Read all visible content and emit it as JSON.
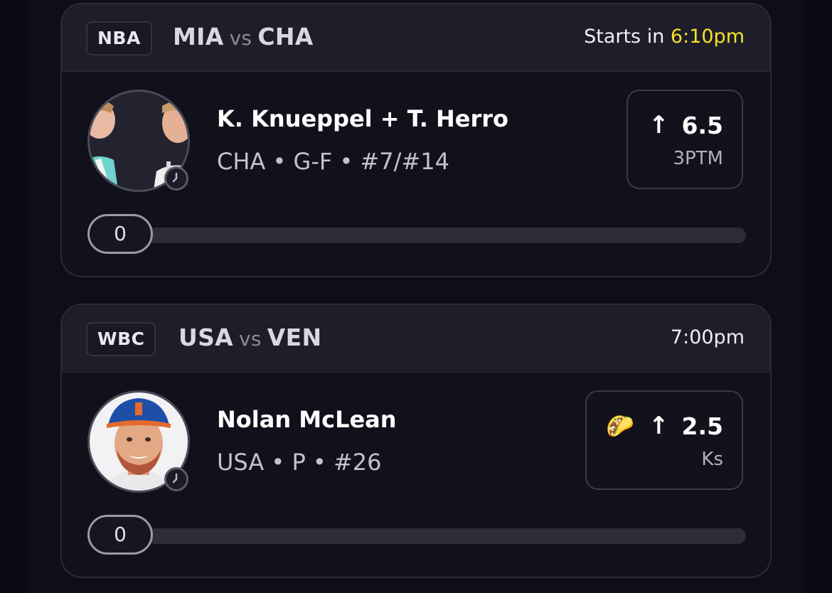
{
  "cards": [
    {
      "league": "NBA",
      "team_a": "MIA",
      "vs": "vs",
      "team_b": "CHA",
      "start_prefix": "Starts in",
      "start_time": "6:10pm",
      "player_name": "K. Knueppel + T. Herro",
      "player_meta": "CHA • G-F • #7/#14",
      "prop_arrow": "↑",
      "prop_value": "6.5",
      "prop_stat": "3PTM",
      "progress_value": "0",
      "icons": {
        "avatar": "player-duo-photo",
        "clock": "clock-icon",
        "arrow": "arrow-up-icon"
      }
    },
    {
      "league": "WBC",
      "team_a": "USA",
      "vs": "vs",
      "team_b": "VEN",
      "start_time": "7:00pm",
      "player_name": "Nolan McLean",
      "player_meta": "USA • P • #26",
      "prop_emoji": "🌮",
      "prop_arrow": "↑",
      "prop_value": "2.5",
      "prop_stat": "Ks",
      "progress_value": "0",
      "icons": {
        "avatar": "player-photo",
        "clock": "clock-icon",
        "arrow": "arrow-up-icon",
        "taco": "taco-icon"
      }
    }
  ],
  "colors": {
    "highlight": "#f6e12a",
    "background": "#0a0b12",
    "card_header": "#1d1e2a"
  }
}
